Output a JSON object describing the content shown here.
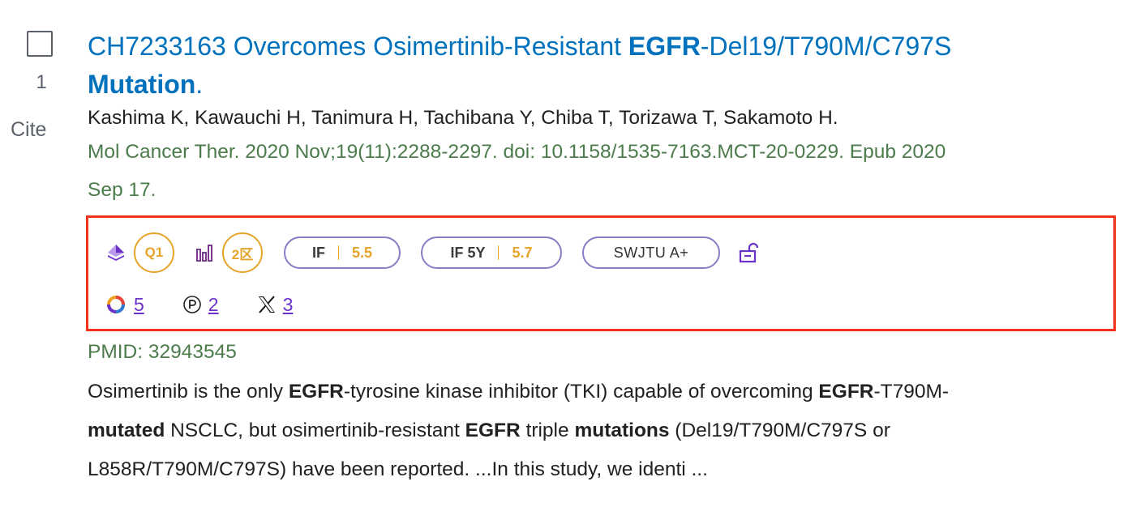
{
  "result": {
    "number": "1",
    "cite_label": "Cite",
    "title_parts": {
      "p1": "CH7233163 Overcomes Osimertinib-Resistant ",
      "b1": "EGFR",
      "p2": "-Del19/T790M/C797S",
      "b2": "Mutation",
      "p3": "."
    },
    "authors": "Kashima K, Kawauchi H, Tanimura H, Tachibana Y, Chiba T, Torizawa T, Sakamoto H.",
    "citation_line1": "Mol Cancer Ther. 2020 Nov;19(11):2288-2297. doi: 10.1158/1535-7163.MCT-20-0229. Epub 2020",
    "citation_line2": "Sep 17.",
    "pmid": "PMID: 32943545"
  },
  "toolbar": {
    "q_badge": "Q1",
    "zone_badge": "2区",
    "if_label": "IF",
    "if_value": "5.5",
    "if5y_label": "IF 5Y",
    "if5y_value": "5.7",
    "rank_label": "SWJTU A+",
    "metrics": {
      "citations": "5",
      "policy": "2",
      "x_mentions": "3"
    },
    "colors": {
      "badge": "#e6a42b",
      "pill_border": "#8a7bc4",
      "link": "#6a32c8",
      "highlight_border": "#f2321a"
    }
  },
  "abstract": {
    "l1a": "Osimertinib is the only ",
    "l1b": "EGFR",
    "l1c": "-tyrosine kinase inhibitor (TKI) capable of overcoming ",
    "l1d": "EGFR",
    "l1e": "-T790M-",
    "l2a": "mutated",
    "l2b": " NSCLC, but osimertinib-resistant ",
    "l2c": "EGFR",
    "l2d": " triple ",
    "l2e": "mutations",
    "l2f": " (Del19/T790M/C797S or",
    "l3": "L858R/T790M/C797S) have been reported. ...In this study, we identi ..."
  }
}
